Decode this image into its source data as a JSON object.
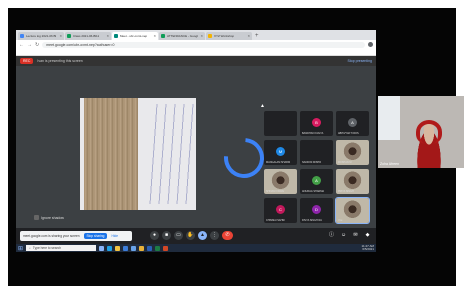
{
  "browser": {
    "tabs": [
      {
        "title": "Lecture log 2021-06 Bl",
        "color": "#4285f4"
      },
      {
        "title": "Class 2021-06-Bl11",
        "color": "#0f9d58"
      },
      {
        "title": "Meet - ubr-oxmt-nep",
        "color": "#00897b",
        "active": true
      },
      {
        "title": "ATTENDANCE - Google",
        "color": "#0f9d58"
      },
      {
        "title": "XYZ Workshop",
        "color": "#f4b400"
      }
    ],
    "new_tab_label": "+",
    "url": "meet.google.com/ubr-oxmt-nep?authuser=0"
  },
  "meet": {
    "rec_label": "REC",
    "meeting_info": "Ivan is presenting this screen",
    "stop_presenting_label": "Stop presenting",
    "presenter_name": "Ignore shadow"
  },
  "participants": [
    {
      "initial": "",
      "color": "#202124",
      "name": ""
    },
    {
      "initial": "B",
      "color": "#d81b60",
      "name": "BANDHAVI KAVYA"
    },
    {
      "initial": "A",
      "color": "#5f6368",
      "name": "ABHIVYAKTI ROS"
    },
    {
      "initial": "M",
      "color": "#1e88e5",
      "name": "MANGALAM SHARM"
    },
    {
      "initial": "",
      "color": "#202124",
      "name": "NANDINI MISHR"
    },
    {
      "initial": "",
      "color": "#202124",
      "name": "ROSHAN M"
    },
    {
      "initial": "",
      "color": "#202124",
      "name": "SHIVAM YADAV"
    },
    {
      "initial": "A",
      "color": "#43a047",
      "name": "ANURAG SHARMA"
    },
    {
      "initial": "",
      "color": "#202124",
      "name": "PRIYA SINGH"
    },
    {
      "initial": "C",
      "color": "#c2185b",
      "name": "CHINMAI SAHNI"
    },
    {
      "initial": "D",
      "color": "#8e24aa",
      "name": "DIVYA SINGH RA"
    },
    {
      "initial": "",
      "color": "#202124",
      "name": "You"
    }
  ],
  "sharebar": {
    "text": "meet.google.com is sharing your screen",
    "stop_label": "Stop sharing",
    "hide_label": "Hide"
  },
  "taskbar": {
    "search_placeholder": "Type here to search",
    "time": "11:27 AM",
    "date": "6/5/2021"
  },
  "self_view": {
    "name": "Zoha Afreen"
  }
}
